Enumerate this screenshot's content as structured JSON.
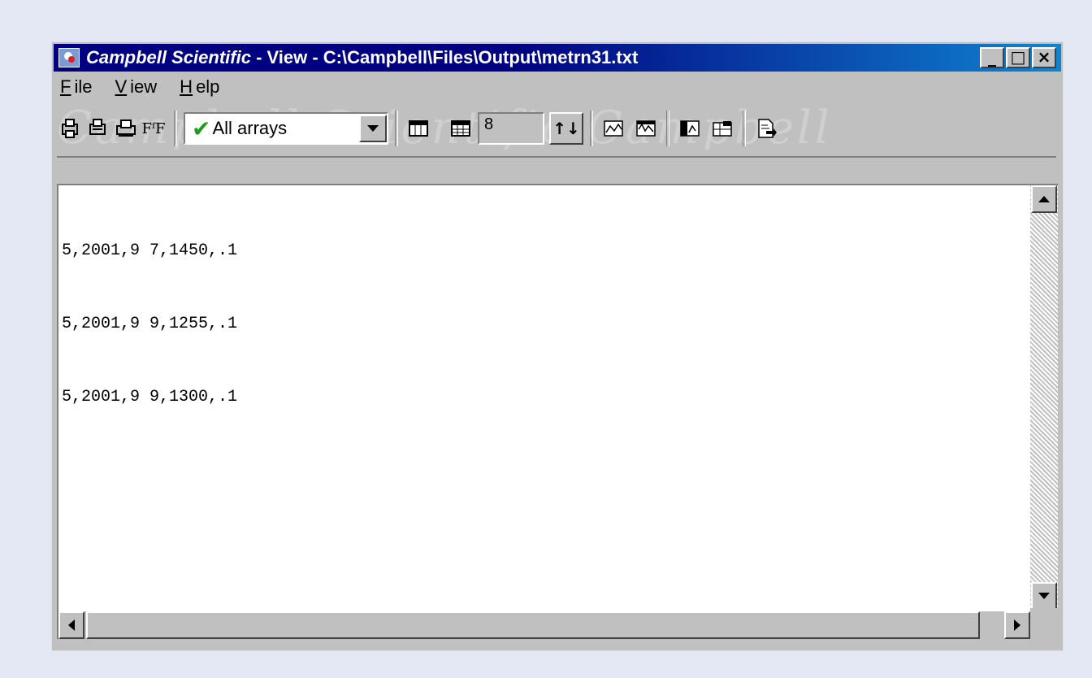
{
  "window": {
    "title_brand": "Campbell Scientific",
    "title_rest": " - View -  C:\\Campbell\\Files\\Output\\metrn31.txt",
    "minimize_glyph": "_",
    "maximize_glyph": "□",
    "close_glyph": "×"
  },
  "menu": {
    "file": {
      "accel": "F",
      "rest": "ile"
    },
    "view": {
      "accel": "V",
      "rest": "iew"
    },
    "help": {
      "accel": "H",
      "rest": "elp"
    }
  },
  "toolbar": {
    "watermark": "Campbell  Scientific  Campbell",
    "icons": {
      "print_preview": "print-preview-icon",
      "page_setup": "page-setup-icon",
      "print": "print-icon",
      "font": "font-icon",
      "grid_view": "grid-view-icon",
      "table_view": "table-view-icon",
      "graph": "graph-icon",
      "graph2": "graph-alt-icon",
      "column_select": "column-select-icon",
      "column_edit": "column-edit-icon",
      "export": "export-icon"
    },
    "font_glyph": "FᶠF",
    "array_select": {
      "value": "All arrays",
      "check": "✔"
    },
    "columns_count": "8",
    "spin_glyph": "↑↓"
  },
  "content": {
    "lines": [
      "5,2001,9 7,1450,.1",
      "5,2001,9 9,1255,.1",
      "5,2001,9 9,1300,.1"
    ]
  },
  "colors": {
    "title_start": "#000080",
    "title_end": "#1084d0",
    "check_green": "#1f9c1f",
    "face": "#c0c0c0",
    "background": "#e3e8f4"
  }
}
